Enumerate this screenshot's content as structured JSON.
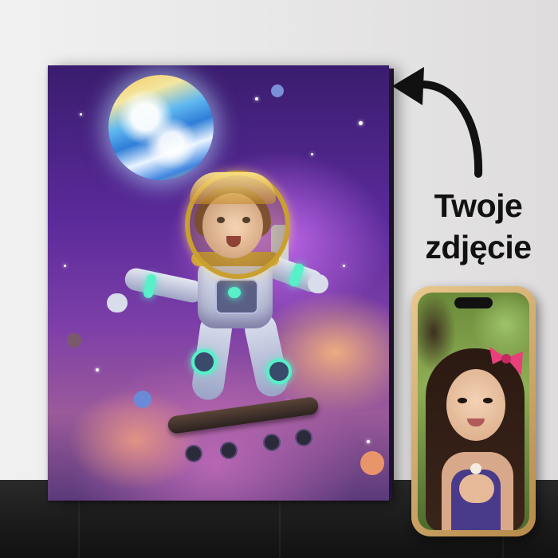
{
  "caption": {
    "line1": "Twoje",
    "line2": "zdjęcie"
  },
  "icons": {
    "arrow": "curved-arrow-left-icon"
  }
}
